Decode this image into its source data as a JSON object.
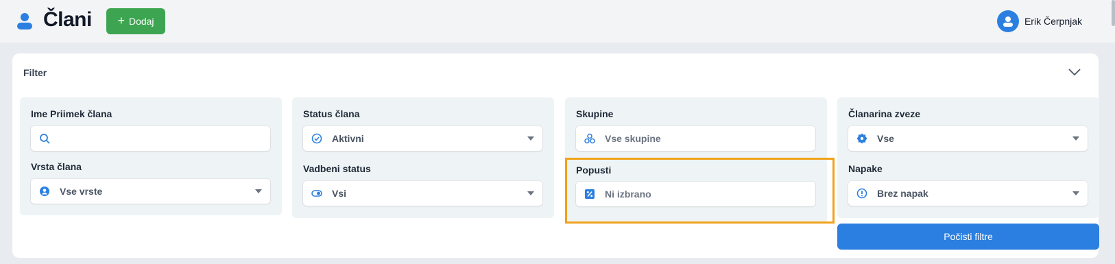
{
  "header": {
    "title": "Člani",
    "add_label": "Dodaj",
    "user_name": "Erik Čerpnjak"
  },
  "filter": {
    "title": "Filter",
    "name_field": {
      "label": "Ime Priimek člana",
      "value": "",
      "placeholder": ""
    },
    "member_type": {
      "label": "Vrsta člana",
      "value": "Vse vrste"
    },
    "member_status": {
      "label": "Status člana",
      "value": "Aktivni"
    },
    "training_status": {
      "label": "Vadbeni status",
      "value": "Vsi"
    },
    "groups": {
      "label": "Skupine",
      "value": "Vse skupine"
    },
    "discounts": {
      "label": "Popusti",
      "value": "Ni izbrano"
    },
    "federation_fee": {
      "label": "Članarina zveze",
      "value": "Vse"
    },
    "errors": {
      "label": "Napake",
      "value": "Brez napak"
    },
    "clear_label": "Počisti filtre"
  },
  "colors": {
    "accent_blue": "#2b7fe0",
    "add_green": "#3da551",
    "highlight_orange": "#f0a21c",
    "panel_bg": "#eef4f5"
  },
  "icons": [
    "user-icon",
    "plus-icon",
    "avatar-icon",
    "chevron-down-icon",
    "search-icon",
    "user-circle-icon",
    "check-circle-icon",
    "toggle-icon",
    "groups-icon",
    "percent-icon",
    "badge-icon",
    "alert-circle-icon"
  ]
}
